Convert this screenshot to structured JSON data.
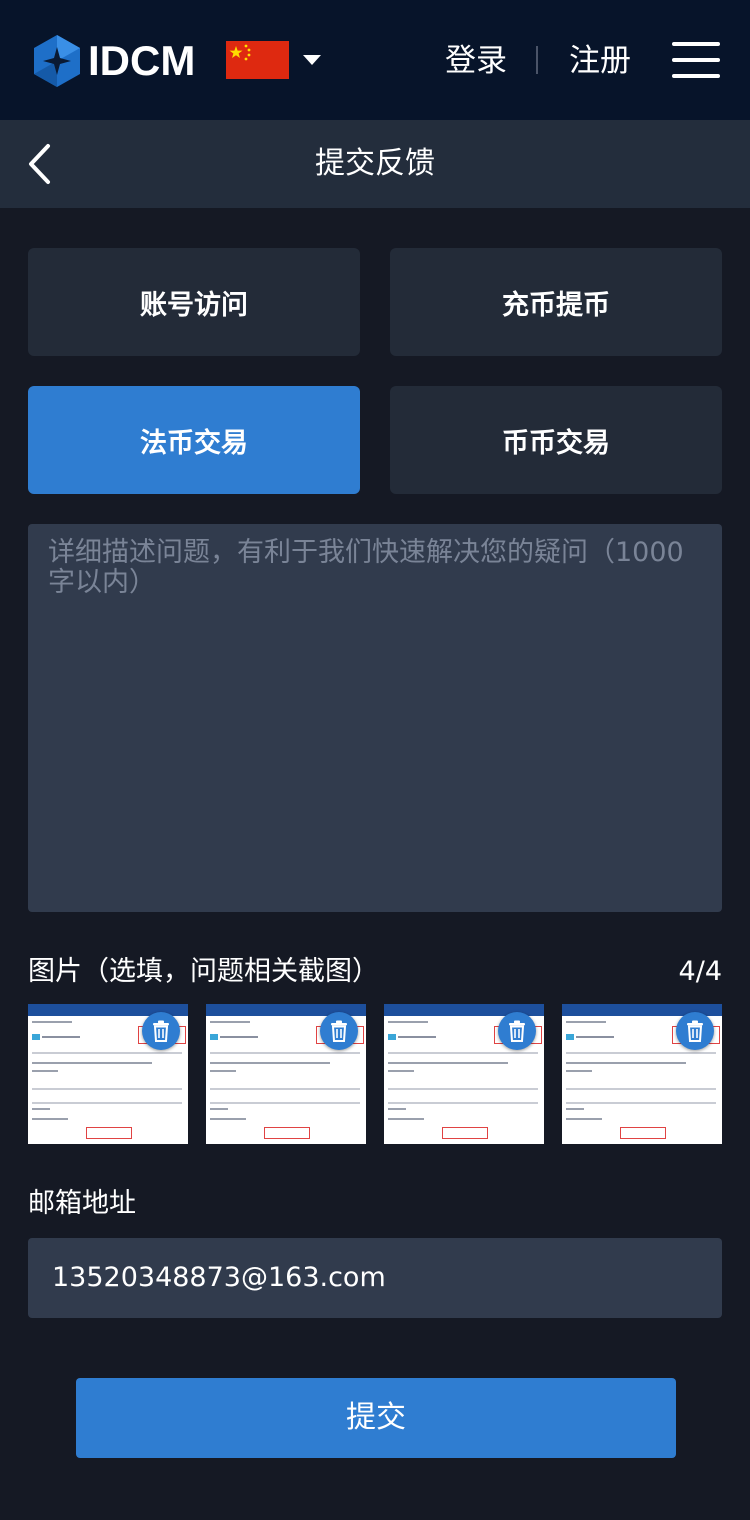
{
  "header": {
    "brand": "IDCM",
    "login": "登录",
    "register": "注册"
  },
  "subheader": {
    "title": "提交反馈"
  },
  "categories": [
    {
      "label": "账号访问",
      "active": false
    },
    {
      "label": "充币提币",
      "active": false
    },
    {
      "label": "法币交易",
      "active": true
    },
    {
      "label": "币币交易",
      "active": false
    }
  ],
  "description": {
    "placeholder": "详细描述问题，有利于我们快速解决您的疑问（1000字以内）"
  },
  "images": {
    "label": "图片（选填，问题相关截图）",
    "count": "4/4"
  },
  "email": {
    "label": "邮箱地址",
    "value": "13520348873@163.com"
  },
  "submit_label": "提交",
  "colors": {
    "accent": "#2f7dd1",
    "topbar": "#07142a",
    "background": "#151924"
  }
}
